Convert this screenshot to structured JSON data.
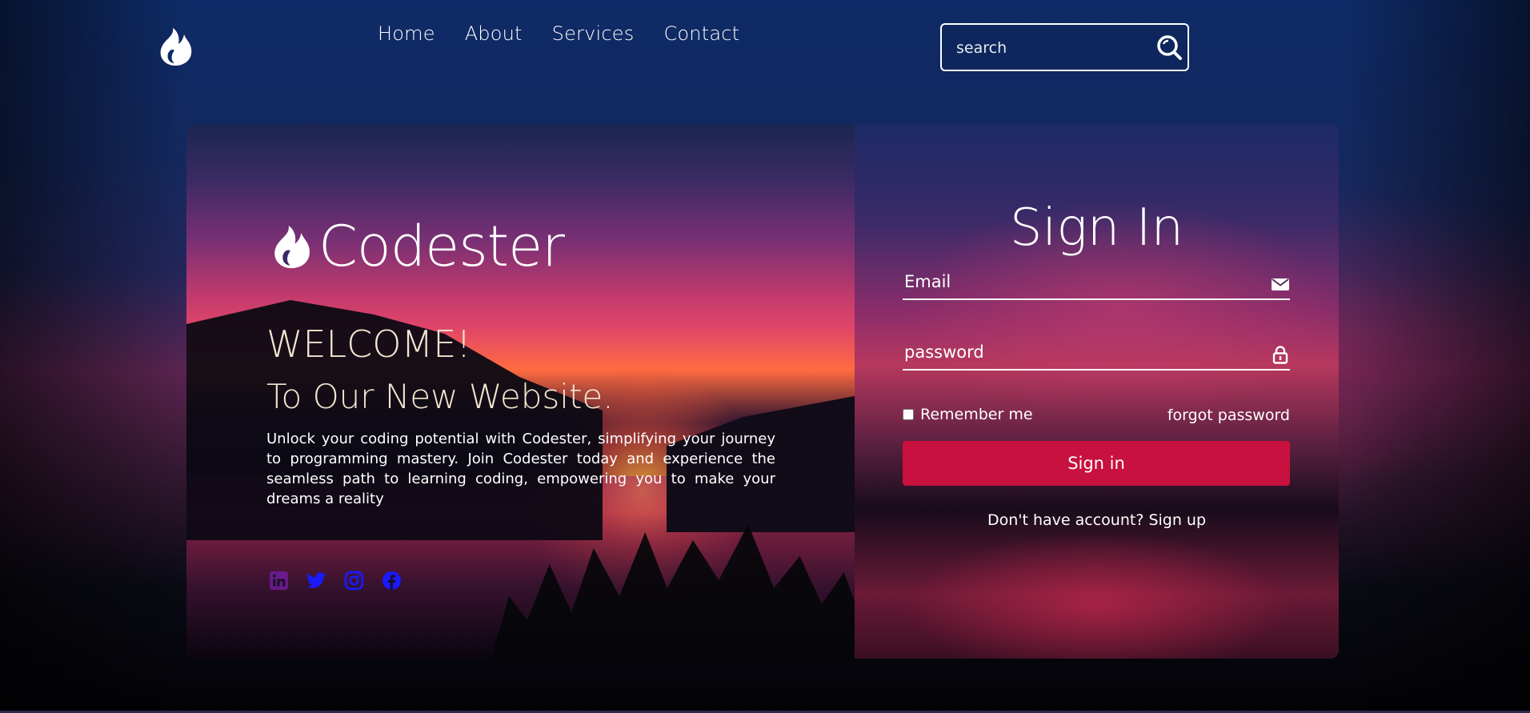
{
  "header": {
    "nav": [
      {
        "label": "Home"
      },
      {
        "label": "About"
      },
      {
        "label": "Services"
      },
      {
        "label": "Contact"
      }
    ],
    "search": {
      "placeholder": "search"
    }
  },
  "hero": {
    "brand_name": "Codester",
    "welcome": "WELCOME!",
    "subtitle": "To Our New Website.",
    "description": "Unlock your coding potential with Codester, simplifying your journey to programming mastery. Join Codester today and experience the seamless path to learning coding, empowering you to make your dreams a reality",
    "socials": [
      {
        "icon": "linkedin-icon",
        "color": "#6a1a8a"
      },
      {
        "icon": "twitter-icon",
        "color": "#1a1aff"
      },
      {
        "icon": "instagram-icon",
        "color": "#1a1aff"
      },
      {
        "icon": "facebook-icon",
        "color": "#1a1aff"
      }
    ]
  },
  "signin": {
    "title": "Sign In",
    "email_placeholder": "Email",
    "password_placeholder": "password",
    "remember_label": "Remember me",
    "forgot_label": "forgot password",
    "button_label": "Sign in",
    "signup_prompt": "Don't have account? Sign up"
  },
  "colors": {
    "accent": "#c8113e",
    "text": "#ffffff",
    "heading_cream": "#f3e6cf"
  }
}
